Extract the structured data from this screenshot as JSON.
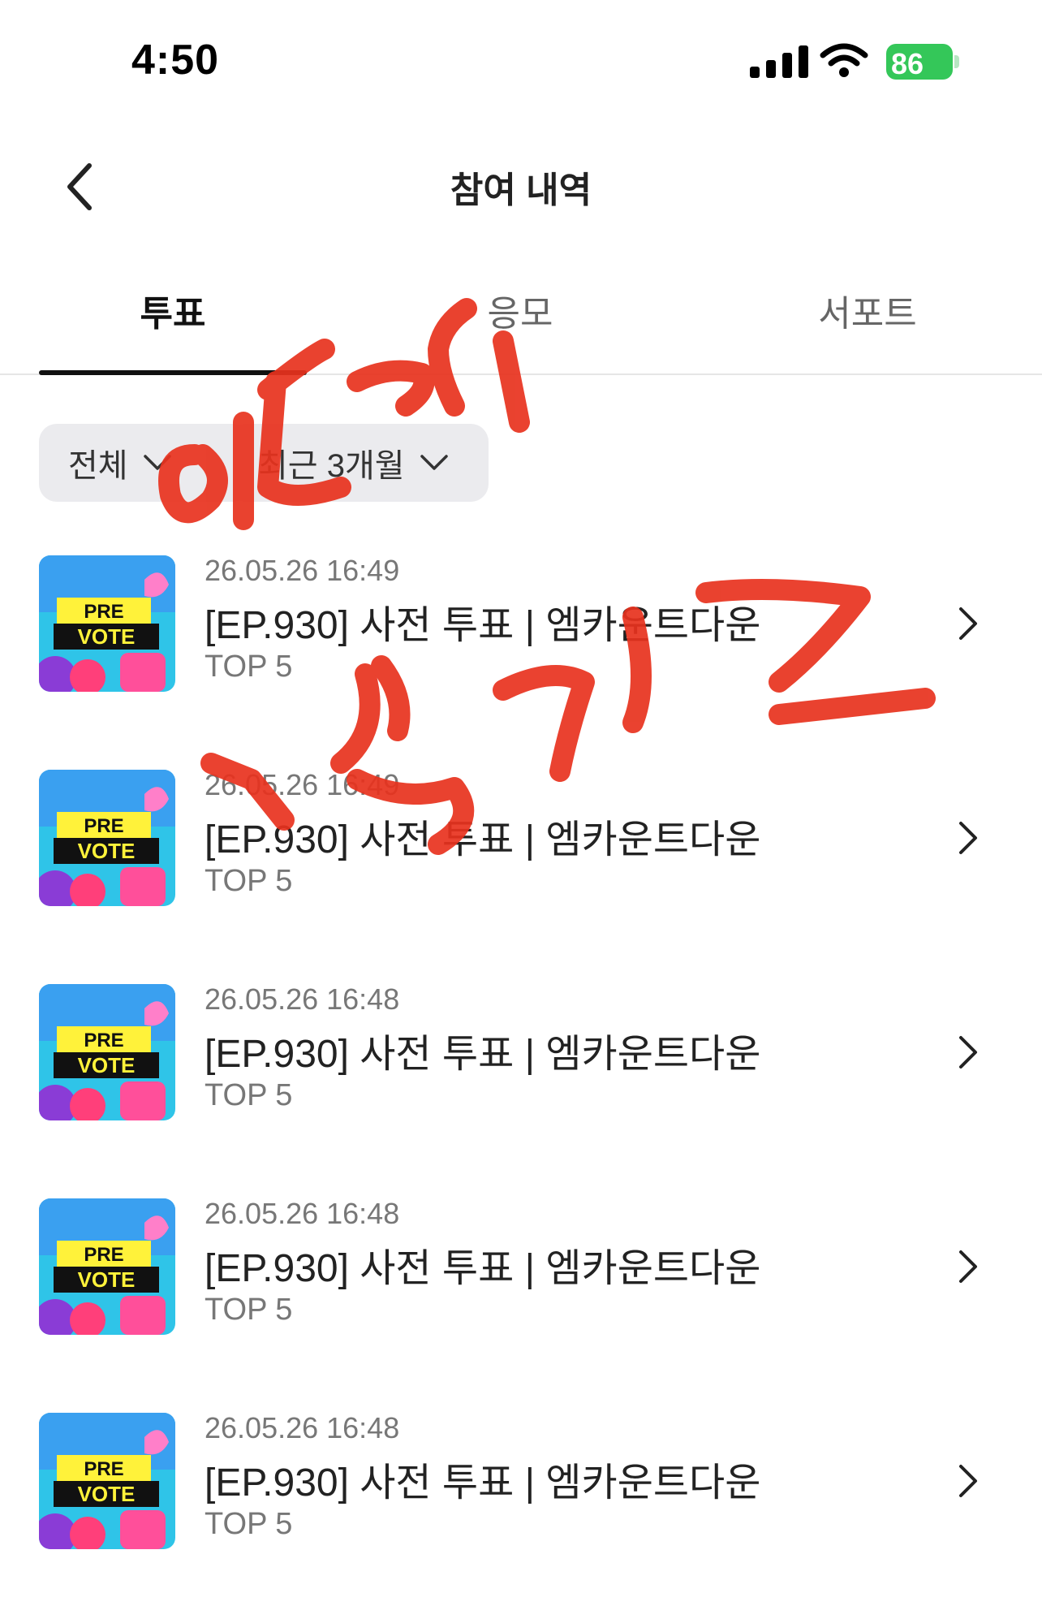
{
  "status_bar": {
    "time": "4:50",
    "battery": "86",
    "icons": [
      "signal-icon",
      "wifi-icon",
      "battery-icon"
    ]
  },
  "header": {
    "title": "참여 내역",
    "back_icon": "chevron-left-icon"
  },
  "tabs": [
    {
      "label": "투표",
      "active": true
    },
    {
      "label": "응모",
      "active": false
    },
    {
      "label": "서포트",
      "active": false
    }
  ],
  "filters": [
    {
      "label": "전체",
      "icon": "chevron-down-icon"
    },
    {
      "label": "최근 3개월",
      "icon": "chevron-down-icon"
    }
  ],
  "items": [
    {
      "date": "26.05.26 16:49",
      "title": "[EP.930] 사전 투표 | 엠카운트다운",
      "rank": "TOP 5",
      "thumb_text": [
        "PRE",
        "VOTE"
      ]
    },
    {
      "date": "26.05.26 16:49",
      "title": "[EP.930] 사전 투표 | 엠카운트다운",
      "rank": "TOP 5",
      "thumb_text": [
        "PRE",
        "VOTE"
      ]
    },
    {
      "date": "26.05.26 16:48",
      "title": "[EP.930] 사전 투표 | 엠카운트다운",
      "rank": "TOP 5",
      "thumb_text": [
        "PRE",
        "VOTE"
      ]
    },
    {
      "date": "26.05.26 16:48",
      "title": "[EP.930] 사전 투표 | 엠카운트다운",
      "rank": "TOP 5",
      "thumb_text": [
        "PRE",
        "VOTE"
      ]
    },
    {
      "date": "26.05.26 16:48",
      "title": "[EP.930] 사전 투표 | 엠카운트다운",
      "rank": "TOP 5",
      "thumb_text": [
        "PRE",
        "VOTE"
      ]
    }
  ],
  "colors": {
    "accent": "#111111",
    "battery": "#34c759",
    "scribble": "#e8321e",
    "filter_bg": "#ebebee"
  }
}
